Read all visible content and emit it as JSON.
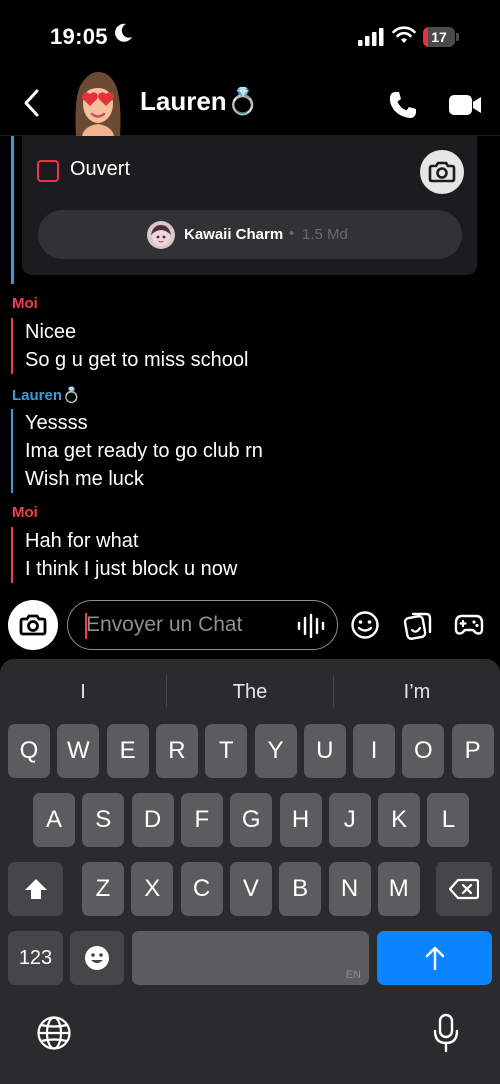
{
  "status_bar": {
    "time": "19:05",
    "battery": "17",
    "battery_level_pct": 17
  },
  "header": {
    "contact_name": "Lauren💍"
  },
  "snap_card": {
    "status_label": "Ouvert",
    "charm_name": "Kawaii Charm",
    "charm_separator": "•",
    "charm_meta": "1.5 Md"
  },
  "messages": [
    {
      "sender": "Moi",
      "side": "me",
      "lines": [
        "Nicee",
        "So g u get to miss school"
      ]
    },
    {
      "sender": "Lauren💍",
      "side": "them",
      "lines": [
        "Yessss",
        "Ima get ready to go club rn",
        "Wish me luck"
      ]
    },
    {
      "sender": "Moi",
      "side": "me",
      "lines": [
        "Hah for what",
        "I think I just block u now"
      ]
    }
  ],
  "composer": {
    "placeholder": "Envoyer un Chat"
  },
  "keyboard": {
    "suggestions": [
      "I",
      "The",
      "I’m"
    ],
    "rows": [
      [
        "Q",
        "W",
        "E",
        "R",
        "T",
        "Y",
        "U",
        "I",
        "O",
        "P"
      ],
      [
        "A",
        "S",
        "D",
        "F",
        "G",
        "H",
        "J",
        "K",
        "L"
      ],
      [
        "Z",
        "X",
        "C",
        "V",
        "B",
        "N",
        "M"
      ]
    ],
    "numbers_key": "123",
    "language": "EN"
  },
  "colors": {
    "me": "#f0404c",
    "them": "#3f9bd8",
    "send": "#0a84ff"
  },
  "icons": [
    "moon-icon",
    "signal-icon",
    "wifi-icon",
    "battery-icon",
    "back-chevron-icon",
    "phone-icon",
    "video-camera-icon",
    "camera-icon",
    "voice-waveform-icon",
    "emoji-icon",
    "sticker-icon",
    "gamepad-icon",
    "shift-icon",
    "backspace-icon",
    "emoji-keyboard-icon",
    "send-arrow-icon",
    "globe-icon",
    "microphone-icon"
  ]
}
